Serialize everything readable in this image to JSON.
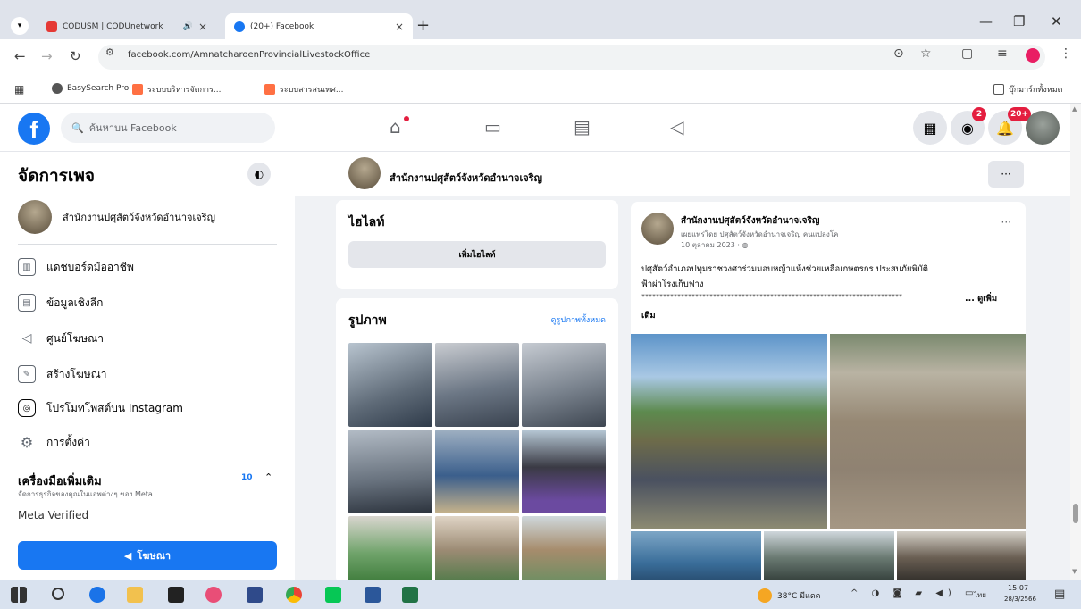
{
  "browser": {
    "tabs": [
      {
        "title": "CODUSM | CODUnetwork",
        "active": false
      },
      {
        "title": "(20+) Facebook",
        "active": true
      }
    ],
    "url": "facebook.com/AmnatcharoenProvincialLivestockOffice",
    "bookmarks": [
      "EasySearch Pro",
      "ระบบบริหารจัดการ...",
      "ระบบสารสนเทศ..."
    ],
    "all_bookmarks": "บุ๊กมาร์กทั้งหมด"
  },
  "fb": {
    "search_placeholder": "ค้นหาบน Facebook",
    "messenger_badge": "2",
    "notif_badge": "20+"
  },
  "sidebar": {
    "title": "จัดการเพจ",
    "page_name": "สำนักงานปศุสัตว์จังหวัดอำนาจเจริญ",
    "items": [
      {
        "icon": "dashboard-icon",
        "label": "แดชบอร์ดมืออาชีพ"
      },
      {
        "icon": "insights-icon",
        "label": "ข้อมูลเชิงลึก"
      },
      {
        "icon": "megaphone-icon",
        "label": "ศูนย์โฆษณา"
      },
      {
        "icon": "pencil-icon",
        "label": "สร้างโฆษณา"
      },
      {
        "icon": "instagram-icon",
        "label": "โปรโมทโพสต์บน Instagram"
      },
      {
        "icon": "gear-icon",
        "label": "การตั้งค่า"
      }
    ],
    "tools_title": "เครื่องมือเพิ่มเติม",
    "tools_sub": "จัดการธุรกิจของคุณในแอพต่างๆ ของ Meta",
    "tools_badge": "10",
    "meta_verified": "Meta Verified",
    "promote_label": "โฆษณา"
  },
  "page_strip": {
    "name": "สำนักงานปศุสัตว์จังหวัดอำนาจเจริญ",
    "more": "···"
  },
  "intro": {
    "title": "ไฮไลท์",
    "button": "เพิ่มไฮไลท์"
  },
  "photos": {
    "title": "รูปภาพ",
    "see_all": "ดูรูปภาพทั้งหมด"
  },
  "post": {
    "author": "สำนักงานปศุสัตว์จังหวัดอำนาจเจริญ",
    "subtitle": "เผยแพร่โดย ปศุสัตว์จังหวัดอำนาจเจริญ คนแปลงโค",
    "date": "10 ตุลาคม 2023 · ",
    "text_line1": "ปศุสัตว์อำเภอปทุมราชวงศาร่วมมอบหญ้าแห้งช่วยเหลือเกษตรกร ประสบภัยพิบัติ",
    "text_line2": "ฟ้าผ่าโรงเก็บฟาง",
    "stars": "*************************************************************************",
    "see_more": "... ดูเพิ่ม",
    "see_more2": "เติม"
  },
  "taskbar": {
    "weather": "38°C มีแดด",
    "lang": "ไทย",
    "time": "15:07",
    "date": "28/3/2566"
  },
  "colors": {
    "fb_blue": "#1877f2",
    "badge_red": "#e41e3f",
    "bg": "#f0f2f5"
  }
}
